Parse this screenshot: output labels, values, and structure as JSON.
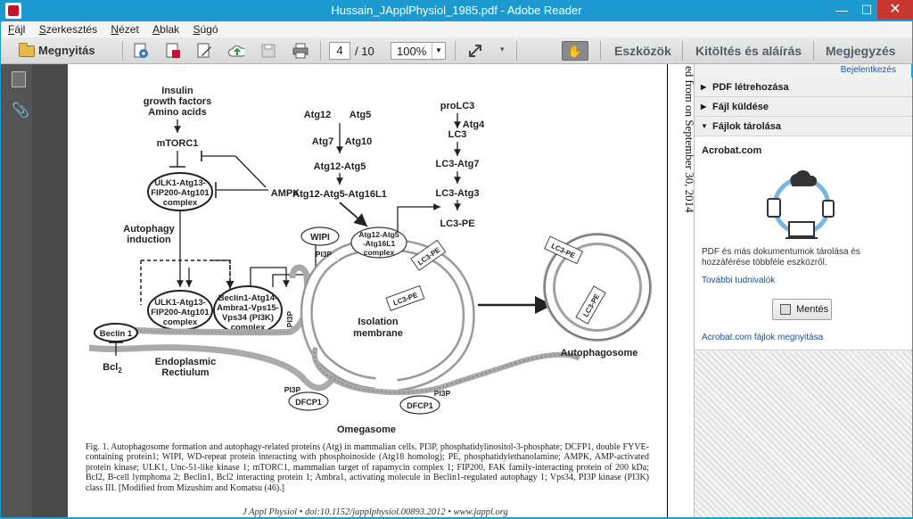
{
  "window": {
    "title": "Hussain_JApplPhysiol_1985.pdf - Adobe Reader",
    "min": "—",
    "max": "☐",
    "close": "✕"
  },
  "menu": [
    {
      "u": "F",
      "rest": "ájl"
    },
    {
      "u": "S",
      "rest": "zerkesztés"
    },
    {
      "u": "N",
      "rest": "ézet"
    },
    {
      "u": "A",
      "rest": "blak"
    },
    {
      "u": "S",
      "rest": "úgó"
    }
  ],
  "toolbar": {
    "open_label": "Megnyitás",
    "page_current": "4",
    "page_total": "/ 10",
    "zoom": "100%",
    "tabs": [
      "Eszközök",
      "Kitöltés és aláírás",
      "Megjegyzés"
    ]
  },
  "document": {
    "side_text": "ed from on September 30, 2014",
    "diagram_labels": {
      "insulin": "Insulin",
      "growth": "growth factors",
      "amino": "Amino acids",
      "mtorc1": "mTORC1",
      "ulk1_top_1": "ULK1-Atg13-",
      "ulk1_top_2": "FIP200-Atg101",
      "ulk1_top_3": "complex",
      "ampk": "AMPK",
      "autophagy1": "Autophagy",
      "autophagy2": "induction",
      "ulk1_bot_1": "ULK1-Atg13-",
      "ulk1_bot_2": "FIP200-Atg101",
      "ulk1_bot_3": "complex",
      "beclin_1": "Beclin1-Atg14-",
      "beclin_2": "Ambra1-Vps15-",
      "beclin_3": "Vps34 (PI3K)",
      "beclin_4": "complex",
      "beclin1": "Beclin 1",
      "bcl2": "Bcl",
      "bcl2_sub": "2",
      "er1": "Endoplasmic",
      "er2": "Rectiulum",
      "atg12": "Atg12",
      "atg5": "Atg5",
      "atg7": "Atg7",
      "atg10": "Atg10",
      "atg12atg5": "Atg12-Atg5",
      "atg16l1": "Atg12-Atg5-Atg16L1",
      "wipi": "WIPI",
      "pi3p_a": "PI3P",
      "ell_1": "Atg12-Atg5",
      "ell_2": "-Atg16L1",
      "ell_3": "complex",
      "lc3pe_a": "LC3-PE",
      "lc3pe_b": "LC3-PE",
      "pi3p_b": "PI3P",
      "isolation1": "Isolation",
      "isolation2": "membrane",
      "prolc3": "proLC3",
      "atg4": "Atg4",
      "lc3": "LC3",
      "lc3atg7": "LC3-Atg7",
      "lc3atg3": "LC3-Atg3",
      "lc3pe": "LC3-PE",
      "lc3pe_c": "LC3-PE",
      "lc3pe_d": "LC3-PE",
      "autophagosome": "Autophagosome",
      "pi3p_c": "PI3P",
      "dfcp1_a": "DFCP1",
      "pi3p_d": "PI3P",
      "dfcp1_b": "DFCP1",
      "omegasome": "Omegasome"
    },
    "caption": "Fig. 1. Autophagosome formation and autophagy-related proteins (Atg) in mammalian cells. PI3P, phosphatidylinositol-3-phosphate; DCFP1, double FYVE-containing protein1; WIPI, WD-repeat protein interacting with phosphoinoside (Atg18 homolog); PE, phosphatidylethanolamine; AMPK, AMP-activated protein kinase; ULK1, Unc-51-like kinase 1; mTORC1, mammalian target of rapamycin complex 1; FIP200, FAK family-interacting protein of 200 kDa; Bcl2, B-cell lymphoma 2; Beclin1, Bcl2 interacting protein 1; Ambra1, activating molecule in Beclin1-regulated autophagy 1; Vps34, PI3P kinase (PI3K) class III. [Modified from Mizushim and Komatsu (46).]",
    "journal": "J Appl Physiol • doi:10.1152/japplphysiol.00893.2012 • www.jappl.org"
  },
  "right_pane": {
    "login": "Bejelentkezés",
    "sections": [
      "PDF létrehozása",
      "Fájl küldése",
      "Fájlok tárolása"
    ],
    "section_icons": [
      "triangle-right-icon",
      "triangle-right-icon",
      "triangle-down-icon"
    ],
    "section_arrows": [
      "▶",
      "▶",
      "▼"
    ],
    "acrobat_title": "Acrobat.com",
    "description": "PDF és más dokumentumok tárolása és hozzáférése többféle eszközről.",
    "more_link": "További tudnivalók",
    "save_label": "Mentés",
    "open_files_link": "Acrobat.com fájlok megnyitása"
  }
}
